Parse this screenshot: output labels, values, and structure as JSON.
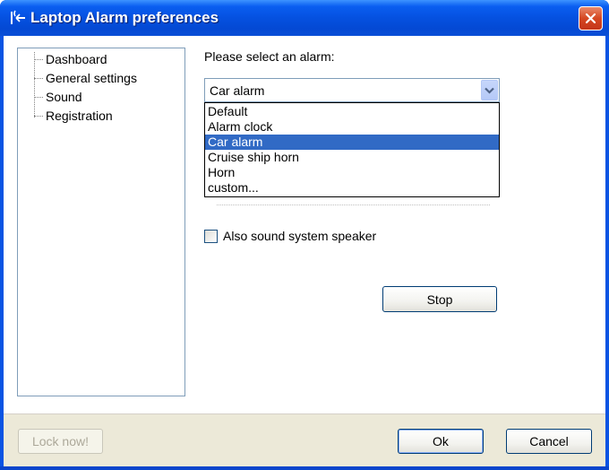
{
  "window": {
    "title": "Laptop Alarm preferences"
  },
  "sidebar": {
    "items": [
      {
        "label": "Dashboard"
      },
      {
        "label": "General settings"
      },
      {
        "label": "Sound"
      },
      {
        "label": "Registration"
      }
    ]
  },
  "sound": {
    "prompt": "Please select an alarm:",
    "selected_value": "Car alarm",
    "options": [
      {
        "label": "Default"
      },
      {
        "label": "Alarm clock"
      },
      {
        "label": "Car alarm",
        "selected": true
      },
      {
        "label": "Cruise ship horn"
      },
      {
        "label": "Horn"
      },
      {
        "label": "custom..."
      }
    ],
    "checkbox_label": "Also sound system speaker",
    "checkbox_checked": false,
    "stop_label": "Stop"
  },
  "footer": {
    "lock_label": "Lock now!",
    "ok_label": "Ok",
    "cancel_label": "Cancel"
  },
  "colors": {
    "titlebar": "#0551e0",
    "selection": "#316ac5",
    "close_button": "#d54721"
  }
}
